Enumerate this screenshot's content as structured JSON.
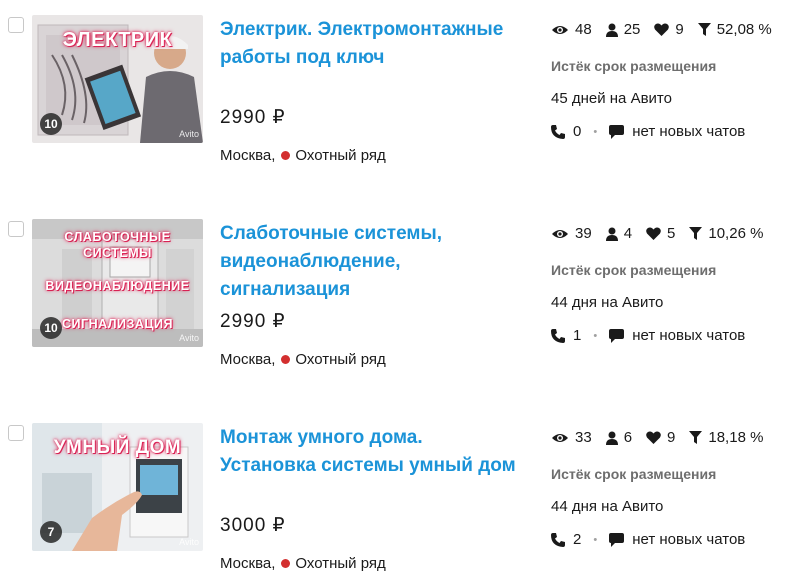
{
  "colors": {
    "link": "#1b93d8",
    "metro_red": "#d32f2f",
    "muted": "#6e6e6e"
  },
  "icons": {
    "views": "eye-icon",
    "contacts": "person-icon",
    "favorites": "heart-icon",
    "conversion": "funnel-icon",
    "calls": "phone-icon",
    "chats": "chat-bubble-icon"
  },
  "items": [
    {
      "title": "Электрик. Электромонтажные работы под ключ",
      "price": "2990 ₽",
      "city": "Москва,",
      "metro": "Охотный ряд",
      "photo_count": "10",
      "thumb_text": [
        "ЭЛЕКТРИК"
      ],
      "watermark": "Avito",
      "stats": {
        "views": "48",
        "contacts": "25",
        "favorites": "9",
        "conversion": "52,08 %"
      },
      "status": "Истёк срок размещения",
      "expiry": "45 дней на Авито",
      "calls": "0",
      "chats": "нет новых чатов"
    },
    {
      "title": "Слаботочные системы, видеонаблюдение, сигнализация",
      "price": "2990 ₽",
      "city": "Москва,",
      "metro": "Охотный ряд",
      "photo_count": "10",
      "thumb_text": [
        "СЛАБОТОЧНЫЕ",
        "СИСТЕМЫ",
        "ВИДЕОНАБЛЮДЕНИЕ",
        "СИГНАЛИЗАЦИЯ"
      ],
      "watermark": "Avito",
      "stats": {
        "views": "39",
        "contacts": "4",
        "favorites": "5",
        "conversion": "10,26 %"
      },
      "status": "Истёк срок размещения",
      "expiry": "44 дня на Авито",
      "calls": "1",
      "chats": "нет новых чатов"
    },
    {
      "title": "Монтаж умного дома. Установка системы умный дом",
      "price": "3000 ₽",
      "city": "Москва,",
      "metro": "Охотный ряд",
      "photo_count": "7",
      "thumb_text": [
        "УМНЫЙ ДОМ"
      ],
      "watermark": "Avito",
      "stats": {
        "views": "33",
        "contacts": "6",
        "favorites": "9",
        "conversion": "18,18 %"
      },
      "status": "Истёк срок размещения",
      "expiry": "44 дня на Авито",
      "calls": "2",
      "chats": "нет новых чатов"
    }
  ]
}
